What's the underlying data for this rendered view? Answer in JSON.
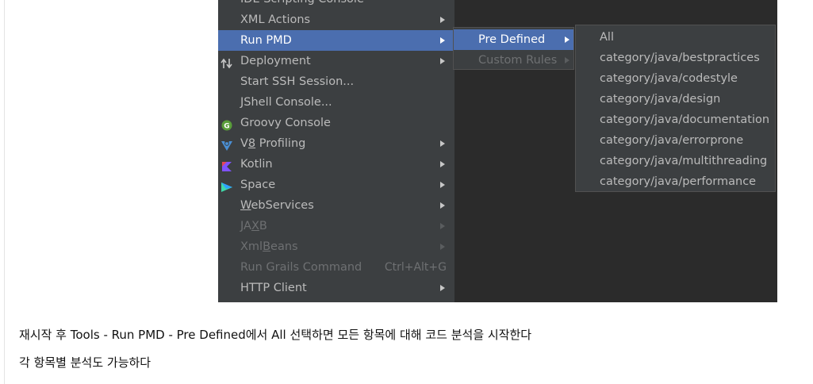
{
  "main_menu": {
    "items": [
      {
        "label": "IDE Scripting Console",
        "arrow": false,
        "state": "normal"
      },
      {
        "label": "XML Actions",
        "arrow": true,
        "state": "normal"
      },
      {
        "label": "Run PMD",
        "arrow": true,
        "state": "selected"
      },
      {
        "label": "Deployment",
        "arrow": true,
        "state": "normal",
        "icon": "deployment-arrows-icon"
      },
      {
        "label": "Start SSH Session...",
        "arrow": false,
        "state": "normal"
      },
      {
        "label": "JShell Console...",
        "arrow": false,
        "state": "normal"
      },
      {
        "label": "Groovy Console",
        "arrow": false,
        "state": "normal",
        "icon": "groovy-icon"
      },
      {
        "label": "V8 Profiling",
        "arrow": true,
        "state": "normal",
        "icon": "v8-icon"
      },
      {
        "label": "Kotlin",
        "arrow": true,
        "state": "normal",
        "icon": "kotlin-icon"
      },
      {
        "label": "Space",
        "arrow": true,
        "state": "normal",
        "icon": "space-icon"
      },
      {
        "label": "WebServices",
        "arrow": true,
        "state": "normal"
      },
      {
        "label": "JAXB",
        "arrow": true,
        "state": "disabled"
      },
      {
        "label": "XmlBeans",
        "arrow": true,
        "state": "disabled"
      },
      {
        "label": "Run Grails Command",
        "shortcut": "Ctrl+Alt+G",
        "arrow": false,
        "state": "disabled"
      },
      {
        "label": "HTTP Client",
        "arrow": true,
        "state": "normal"
      }
    ]
  },
  "pmd_submenu": {
    "items": [
      {
        "label": "Pre Defined",
        "state": "selected"
      },
      {
        "label": "Custom Rules",
        "state": "disabled"
      }
    ]
  },
  "predefined_submenu": {
    "items": [
      "All",
      "category/java/bestpractices",
      "category/java/codestyle",
      "category/java/design",
      "category/java/documentation",
      "category/java/errorprone",
      "category/java/multithreading",
      "category/java/performance"
    ]
  },
  "caption": {
    "line1": "재시작 후 Tools - Run PMD - Pre Defined에서 All 선택하면 모든 항목에 대해 코드 분석을 시작한다",
    "line2": "각 항목별 분석도 가능하다"
  },
  "colors": {
    "menu_bg": "#3c3f41",
    "selection": "#4b6eaf",
    "text": "#bbbbbb",
    "disabled_text": "#6e7072",
    "editor_bg": "#2b2b2b"
  }
}
